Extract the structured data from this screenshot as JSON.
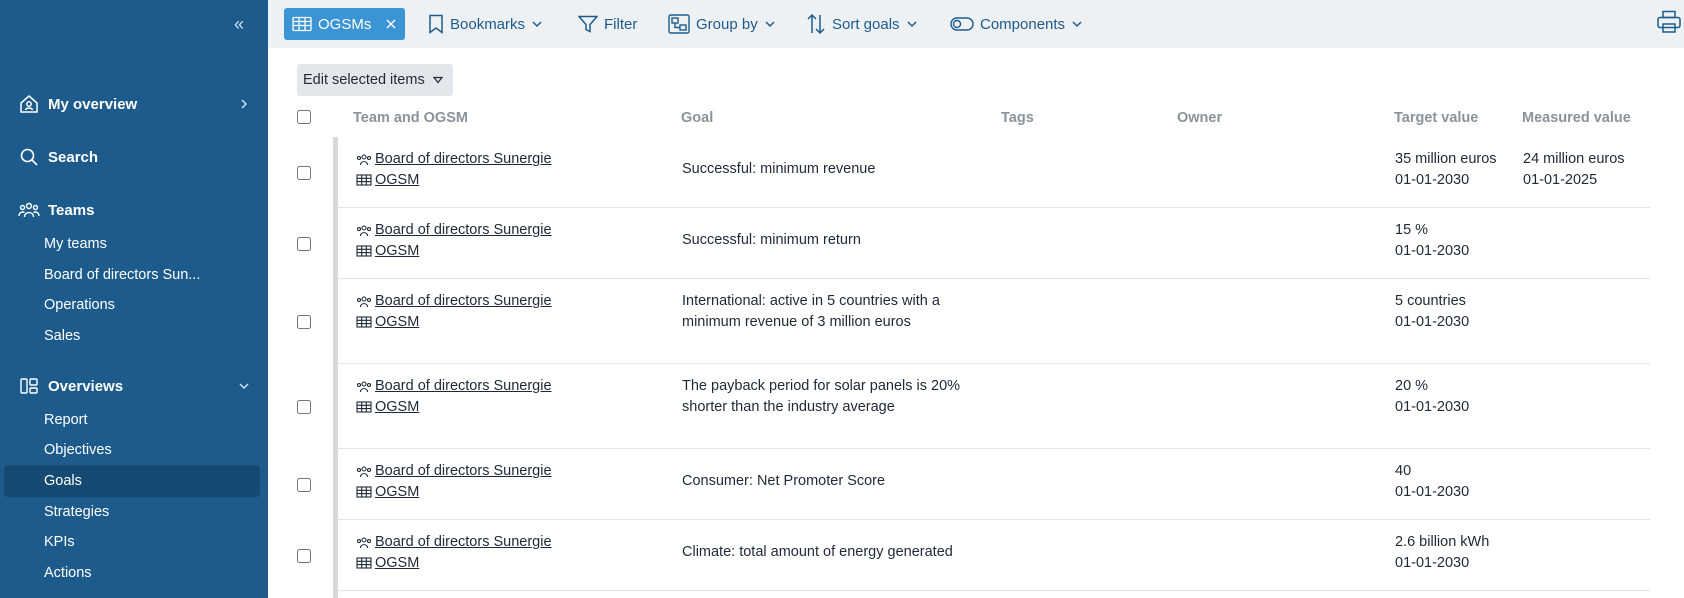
{
  "sidebar": {
    "collapse_icon": "double-chevron-left-icon",
    "nav": [
      {
        "label": "My overview",
        "icon": "home-person-icon"
      },
      {
        "label": "Search",
        "icon": "search-icon"
      },
      {
        "label": "Teams",
        "icon": "team-icon"
      },
      {
        "label": "Overviews",
        "icon": "overview-icon"
      }
    ],
    "teams": [
      "My teams",
      "Board of directors Sun...",
      "Operations",
      "Sales"
    ],
    "overviews": [
      "Report",
      "Objectives",
      "Goals",
      "Strategies",
      "KPIs",
      "Actions"
    ],
    "active_item": "Goals"
  },
  "toolbar": {
    "chip_label": "OGSMs",
    "bookmarks": "Bookmarks",
    "filter": "Filter",
    "group_by": "Group by",
    "sort_goals": "Sort goals",
    "components": "Components"
  },
  "edit_selected": "Edit selected items",
  "table": {
    "headers": {
      "team": "Team and OGSM",
      "goal": "Goal",
      "tags": "Tags",
      "owner": "Owner",
      "target": "Target value",
      "measured": "Measured value"
    },
    "rows": [
      {
        "team": "Board of directors Sunergie",
        "ogsm": "OGSM",
        "goal": "Successful: minimum revenue",
        "target_value": "35 million euros",
        "target_date": "01-01-2030",
        "measured_value": "24 million euros",
        "measured_date": "01-01-2025"
      },
      {
        "team": "Board of directors Sunergie",
        "ogsm": "OGSM",
        "goal": "Successful: minimum return",
        "target_value": "15 %",
        "target_date": "01-01-2030",
        "measured_value": "",
        "measured_date": ""
      },
      {
        "team": "Board of directors Sunergie",
        "ogsm": "OGSM",
        "goal": "International: active in 5 countries with a minimum revenue of 3 million euros",
        "target_value": "5 countries",
        "target_date": "01-01-2030",
        "measured_value": "",
        "measured_date": ""
      },
      {
        "team": "Board of directors Sunergie",
        "ogsm": "OGSM",
        "goal": "The payback period for solar panels is 20% shorter than the industry average",
        "target_value": "20 %",
        "target_date": "01-01-2030",
        "measured_value": "",
        "measured_date": ""
      },
      {
        "team": "Board of directors Sunergie",
        "ogsm": "OGSM",
        "goal": "Consumer: Net Promoter Score",
        "target_value": "40",
        "target_date": "01-01-2030",
        "measured_value": "",
        "measured_date": ""
      },
      {
        "team": "Board of directors Sunergie",
        "ogsm": "OGSM",
        "goal": "Climate: total amount of energy generated",
        "target_value": "2.6 billion kWh",
        "target_date": "01-01-2030",
        "measured_value": "",
        "measured_date": ""
      }
    ]
  },
  "colors": {
    "sidebar_bg": "#1d5b8c",
    "sidebar_active": "#164a73",
    "toolbar_bg": "#eef1f4",
    "accent": "#1d5b8c",
    "chip_bg": "#3b95d4"
  }
}
